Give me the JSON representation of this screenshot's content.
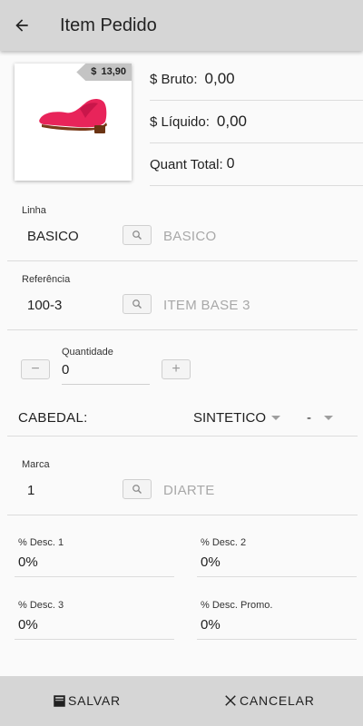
{
  "appbar": {
    "title": "Item Pedido",
    "back_icon": "arrow-left-icon"
  },
  "product": {
    "price_currency": "$",
    "price_value": "13,90",
    "image": "red-sandal-image"
  },
  "summary": {
    "bruto_label": "$ Bruto:",
    "bruto_value": "0,00",
    "liquido_label": "$ Líquido:",
    "liquido_value": "0,00",
    "quant_label": "Quant Total:",
    "quant_value": "0"
  },
  "linha": {
    "label": "Linha",
    "value": "BASICO",
    "description": "BASICO"
  },
  "referencia": {
    "label": "Referência",
    "value": "100-3",
    "description": "ITEM BASE 3"
  },
  "quantidade": {
    "label": "Quantidade",
    "value": "0",
    "minus": "−",
    "plus": "+"
  },
  "cabedal": {
    "label": "CABEDAL:",
    "option1": "SINTETICO",
    "option2": "-"
  },
  "marca": {
    "label": "Marca",
    "value": "1",
    "description": "DIARTE"
  },
  "descontos": {
    "desc1_label": "% Desc. 1",
    "desc1_value": "0%",
    "desc2_label": "% Desc. 2",
    "desc2_value": "0%",
    "desc3_label": "% Desc. 3",
    "desc3_value": "0%",
    "promo_label": "% Desc. Promo.",
    "promo_value": "0%"
  },
  "actions": {
    "save_label": "SALVAR",
    "cancel_label": "CANCELAR"
  },
  "colors": {
    "appbar": "#d6d6d6",
    "shoe": "#e8245a",
    "muted_text": "#a8a8a8"
  }
}
